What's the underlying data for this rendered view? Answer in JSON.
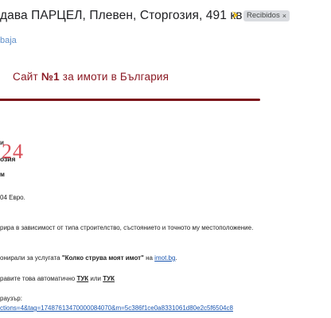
{
  "header": {
    "subject": "дава ПАРЦЕЛ, Плевен, Сторгозия, 491 кв.м",
    "label_chip": "Recibidos",
    "label_remove": "×"
  },
  "sender_fragment": "baja",
  "banner": {
    "prefix": "Сайт ",
    "emphasis": "№1",
    "suffix": " за имоти в България",
    "accent_color": "#7b1219"
  },
  "logo": {
    "mark": "24",
    "heading_fragment": "и",
    "sub_fragment": "озия"
  },
  "body": {
    "line1": "м",
    "line2": "04 Евро.",
    "line3": "рира в зависимост от типа строителство, състоянието и точното му местоположение.",
    "line4_prefix": "онирали за услугата ",
    "line4_service": "\"Колко струва моят имот\"",
    "line4_mid": " на ",
    "line4_link": "imot.bg",
    "line4_end": ".",
    "line5_prefix": "равите това автоматично ",
    "line5_link1": "ТУК",
    "line5_mid": " или ",
    "line5_link2": "ТУК",
    "line6": "раузър:",
    "line7_url": "ctions=4&tag=17487613470000084070&m=5c386f1ce0a8331061d80e2c5f6504c8"
  }
}
